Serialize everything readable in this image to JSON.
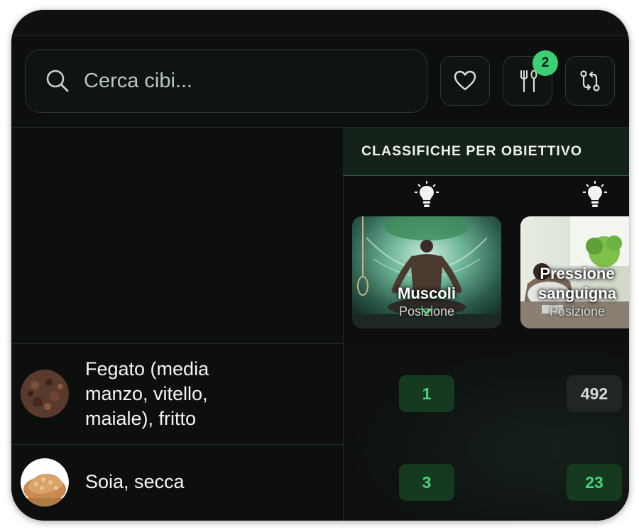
{
  "search": {
    "placeholder": "Cerca cibi..."
  },
  "toolbar": {
    "favorites_icon": "heart-icon",
    "meal_icon": "fork-spoon-icon",
    "meal_badge": "2",
    "compare_icon": "compare-arrows-icon"
  },
  "rankings": {
    "header": "CLASSIFICHE PER OBIETTIVO",
    "goals": [
      {
        "title": "Muscoli",
        "subtitle": "Posizione",
        "tip_icon": "lightbulb-icon"
      },
      {
        "title_line1": "Pressione",
        "title_line2": "sanguigna",
        "subtitle": "Posizione",
        "tip_icon": "lightbulb-icon"
      }
    ]
  },
  "foods": [
    {
      "name_line1": "Fegato (media",
      "name_line2": "manzo, vitello,",
      "name_line3": "maiale), fritto",
      "ranks": [
        "1",
        "492"
      ]
    },
    {
      "name": "Soia, secca",
      "ranks": [
        "3",
        "23"
      ]
    }
  ],
  "colors": {
    "accent": "#3ccf74",
    "background": "#0d0f0e",
    "pill_good": "#163a20",
    "pill_neutral": "#1f2624"
  }
}
